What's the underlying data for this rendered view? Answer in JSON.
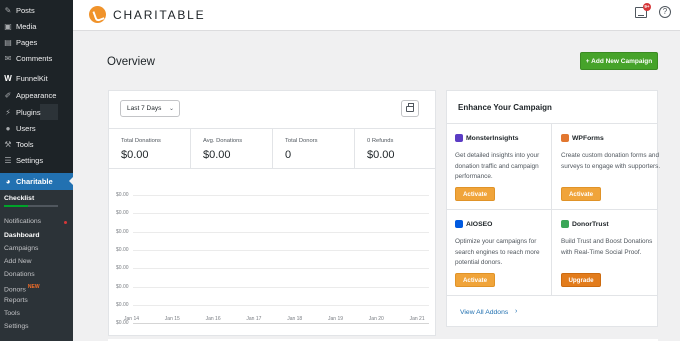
{
  "sidebar": {
    "items": [
      {
        "label": "Posts",
        "icon": "pin-icon"
      },
      {
        "label": "Media",
        "icon": "media-icon"
      },
      {
        "label": "Pages",
        "icon": "page-icon"
      },
      {
        "label": "Comments",
        "icon": "comment-icon"
      },
      {
        "label": "FunnelKit",
        "icon": "funnelkit-icon"
      },
      {
        "label": "Appearance",
        "icon": "brush-icon"
      },
      {
        "label": "Plugins",
        "icon": "plugin-icon"
      },
      {
        "label": "Users",
        "icon": "user-icon"
      },
      {
        "label": "Tools",
        "icon": "wrench-icon"
      },
      {
        "label": "Settings",
        "icon": "settings-icon"
      },
      {
        "label": "Charitable",
        "icon": "charitable-icon"
      }
    ],
    "submenu": {
      "checklist": "Checklist",
      "items": [
        "Notifications",
        "Dashboard",
        "Campaigns",
        "Add New",
        "Donations",
        "Donors",
        "Reports",
        "Tools",
        "Settings"
      ],
      "new_badge": "NEW"
    }
  },
  "header": {
    "logo_text": "CHARITABLE",
    "inbox_count": "9+",
    "help_glyph": "?"
  },
  "page": {
    "title": "Overview",
    "add_button": "+ Add New Campaign"
  },
  "stats": {
    "range_select": "Last 7 Days",
    "items": [
      {
        "label": "Total Donations",
        "value": "$0.00"
      },
      {
        "label": "Avg. Donations",
        "value": "$0.00"
      },
      {
        "label": "Total Donors",
        "value": "0"
      },
      {
        "label": "0 Refunds",
        "value": "$0.00"
      }
    ]
  },
  "chart_data": {
    "type": "line",
    "x": [
      "Jan 14",
      "Jan 15",
      "Jan 16",
      "Jan 17",
      "Jan 18",
      "Jan 19",
      "Jan 20",
      "Jan 21"
    ],
    "y_ticks": [
      "$0.00",
      "$0.00",
      "$0.00",
      "$0.00",
      "$0.00",
      "$0.00",
      "$0.00",
      "$0.00"
    ],
    "series": [
      {
        "values": [
          0,
          0,
          0,
          0,
          0,
          0,
          0,
          0
        ]
      }
    ],
    "grid": true
  },
  "enhance": {
    "title": "Enhance Your Campaign",
    "addons": [
      {
        "name": "MonsterInsights",
        "desc": "Get detailed insights into your donation traffic and campaign performance.",
        "button": "Activate",
        "color": "#5b3cc4"
      },
      {
        "name": "WPForms",
        "desc": "Create custom donation forms and surveys to engage with supporters.",
        "button": "Activate",
        "color": "#e27730"
      },
      {
        "name": "AIOSEO",
        "desc": "Optimize your campaigns for search engines to reach more potential donors.",
        "button": "Activate",
        "color": "#005ae0"
      },
      {
        "name": "DonorTrust",
        "desc": "Build Trust and Boost Donations with Real-Time Social Proof.",
        "button": "Upgrade",
        "color": "#3aa657"
      }
    ],
    "view_all": "View All Addons"
  }
}
